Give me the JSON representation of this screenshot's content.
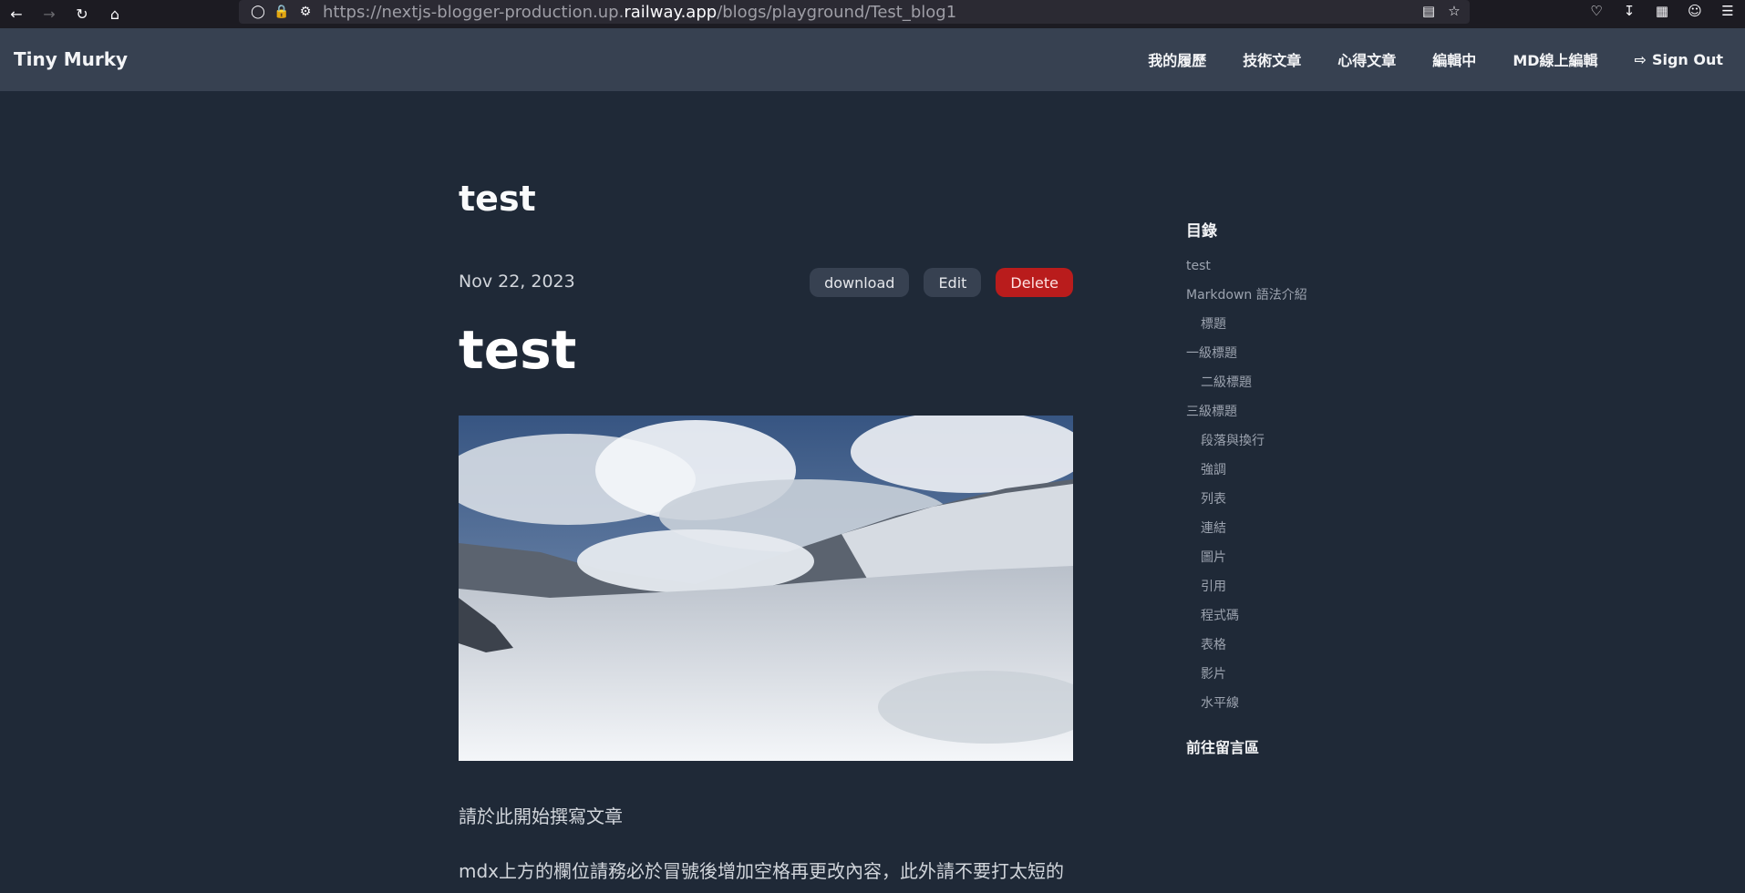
{
  "browser": {
    "url_prefix": "https://nextjs-blogger-production.up.",
    "url_host": "railway.app",
    "url_path": "/blogs/playground/Test_blog1"
  },
  "header": {
    "brand": "Tiny Murky",
    "nav": [
      "我的履歷",
      "技術文章",
      "心得文章",
      "編輯中",
      "MD線上編輯"
    ],
    "sign_out": "Sign Out"
  },
  "post": {
    "title": "test",
    "date": "Nov 22, 2023",
    "actions": {
      "download": "download",
      "edit": "Edit",
      "delete": "Delete"
    },
    "heading": "test",
    "paragraph_1": "請於此開始撰寫文章",
    "paragraph_2": "mdx上方的欄位請務必於冒號後增加空格再更改內容，此外請不要打太短的"
  },
  "toc": {
    "title": "目錄",
    "items": [
      {
        "label": "test",
        "level": 1
      },
      {
        "label": "Markdown 語法介紹",
        "level": 1
      },
      {
        "label": "標題",
        "level": 2
      },
      {
        "label": "一級標題",
        "level": 1
      },
      {
        "label": "二級標題",
        "level": 2
      },
      {
        "label": "三級標題",
        "level": 1
      },
      {
        "label": "段落與換行",
        "level": 2
      },
      {
        "label": "強調",
        "level": 2
      },
      {
        "label": "列表",
        "level": 2
      },
      {
        "label": "連結",
        "level": 2
      },
      {
        "label": "圖片",
        "level": 2
      },
      {
        "label": "引用",
        "level": 2
      },
      {
        "label": "程式碼",
        "level": 2
      },
      {
        "label": "表格",
        "level": 2
      },
      {
        "label": "影片",
        "level": 2
      },
      {
        "label": "水平線",
        "level": 2
      }
    ],
    "comments_link": "前往留言區"
  }
}
